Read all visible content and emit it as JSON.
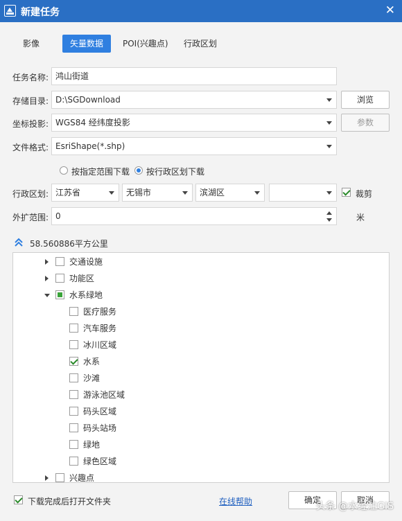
{
  "window": {
    "title": "新建任务",
    "close_glyph": "✕"
  },
  "tabs": [
    {
      "label": "影像",
      "active": false
    },
    {
      "label": "矢量数据",
      "active": true
    },
    {
      "label": "POI(兴趣点)",
      "active": false
    },
    {
      "label": "行政区划",
      "active": false
    }
  ],
  "form": {
    "task_name": {
      "label": "任务名称:",
      "value": "鸿山街道"
    },
    "storage_dir": {
      "label": "存储目录:",
      "value": "D:\\SGDownload",
      "button": "浏览"
    },
    "projection": {
      "label": "坐标投影:",
      "value": "WGS84 经纬度投影",
      "button": "参数"
    },
    "file_format": {
      "label": "文件格式:",
      "value": "EsriShape(*.shp)"
    },
    "download_mode": {
      "options": [
        {
          "label": "按指定范围下载",
          "selected": false
        },
        {
          "label": "按行政区划下载",
          "selected": true
        }
      ]
    },
    "region": {
      "label": "行政区划:",
      "province": "江苏省",
      "city": "无锡市",
      "district": "滨湖区",
      "street": "",
      "clip_label": "裁剪",
      "clip_checked": true
    },
    "buffer": {
      "label": "外扩范围:",
      "value": "0",
      "unit": "米"
    }
  },
  "area": {
    "text": "58.560886平方公里"
  },
  "tree": [
    {
      "label": "交通设施",
      "level": 1,
      "expander": "collapsed",
      "check": "unchecked"
    },
    {
      "label": "功能区",
      "level": 1,
      "expander": "collapsed",
      "check": "unchecked"
    },
    {
      "label": "水系绿地",
      "level": 1,
      "expander": "expanded",
      "check": "partial"
    },
    {
      "label": "医疗服务",
      "level": 2,
      "expander": "none",
      "check": "unchecked"
    },
    {
      "label": "汽车服务",
      "level": 2,
      "expander": "none",
      "check": "unchecked"
    },
    {
      "label": "冰川区域",
      "level": 2,
      "expander": "none",
      "check": "unchecked"
    },
    {
      "label": "水系",
      "level": 2,
      "expander": "none",
      "check": "checked"
    },
    {
      "label": "沙滩",
      "level": 2,
      "expander": "none",
      "check": "unchecked"
    },
    {
      "label": "游泳池区域",
      "level": 2,
      "expander": "none",
      "check": "unchecked"
    },
    {
      "label": "码头区域",
      "level": 2,
      "expander": "none",
      "check": "unchecked"
    },
    {
      "label": "码头站场",
      "level": 2,
      "expander": "none",
      "check": "unchecked"
    },
    {
      "label": "绿地",
      "level": 2,
      "expander": "none",
      "check": "unchecked"
    },
    {
      "label": "绿色区域",
      "level": 2,
      "expander": "none",
      "check": "unchecked"
    },
    {
      "label": "兴趣点",
      "level": 1,
      "expander": "collapsed",
      "check": "unchecked"
    }
  ],
  "footer": {
    "open_folder_label": "下载完成后打开文件夹",
    "open_folder_checked": true,
    "help_link": "在线帮助",
    "ok": "确定",
    "cancel": "取消"
  },
  "watermark": "头条 @水经注GIS",
  "colors": {
    "titlebar": "#2a6fc4",
    "accent": "#2f7fe0",
    "check_green": "#2a8a2a"
  }
}
